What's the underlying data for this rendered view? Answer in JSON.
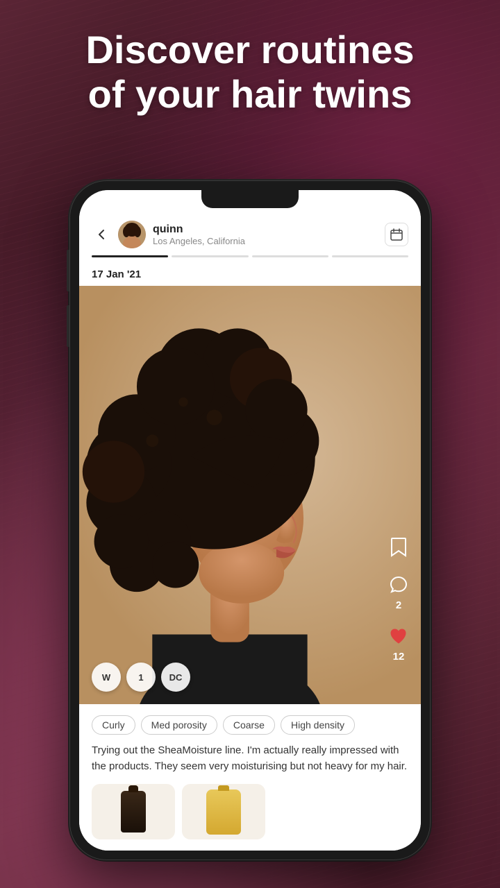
{
  "background": {
    "color": "#3a1a2e"
  },
  "headline": {
    "line1": "Discover routines",
    "line2": "of your hair twins"
  },
  "phone": {
    "header": {
      "back_label": "←",
      "user_name": "quinn",
      "user_location": "Los Angeles, California",
      "calendar_icon": "calendar-icon"
    },
    "progress_bars": [
      {
        "state": "active"
      },
      {
        "state": "inactive"
      },
      {
        "state": "inactive"
      },
      {
        "state": "inactive"
      }
    ],
    "post_date": "17 Jan '21",
    "badges": [
      {
        "label": "W"
      },
      {
        "label": "1"
      },
      {
        "label": "DC"
      }
    ],
    "side_actions": [
      {
        "icon": "bookmark-icon",
        "count": null
      },
      {
        "icon": "comment-icon",
        "count": "2"
      },
      {
        "icon": "heart-icon",
        "count": "12"
      }
    ],
    "tags": [
      {
        "label": "Curly"
      },
      {
        "label": "Med porosity"
      },
      {
        "label": "Coarse"
      },
      {
        "label": "High density"
      }
    ],
    "description": "Trying out the SheaMoisture line. I'm actually really impressed with the products. They seem very moisturising but not heavy for my hair.",
    "products": [
      {
        "type": "dark-bottle"
      },
      {
        "type": "cream-bottle"
      }
    ]
  }
}
